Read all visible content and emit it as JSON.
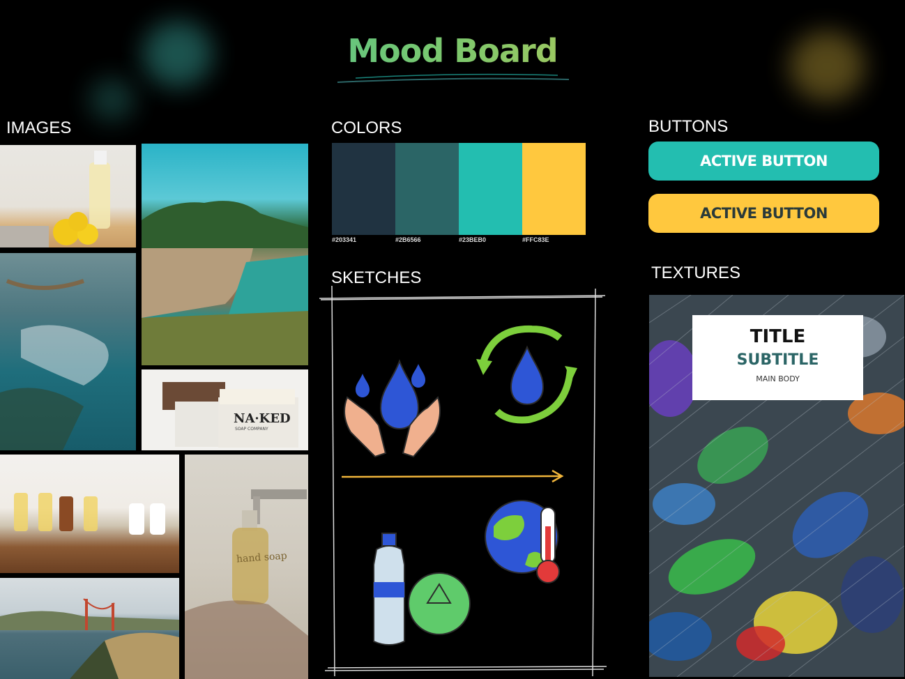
{
  "header": {
    "title": "Mood Board"
  },
  "sections": {
    "images": "IMAGES",
    "colors": "COLORS",
    "sketches": "SKETCHES",
    "buttons": "BUTTONS",
    "textures": "TEXTURES"
  },
  "palette": [
    {
      "hex": "#203341",
      "label": "#203341"
    },
    {
      "hex": "#2B6566",
      "label": "#2B6566"
    },
    {
      "hex": "#23BEB0",
      "label": "#23BEB0"
    },
    {
      "hex": "#FFC83E",
      "label": "#FFC83E"
    }
  ],
  "buttons": {
    "primary_label": "ACTIVE BUTTON",
    "secondary_label": "ACTIVE BUTTON"
  },
  "texture_card": {
    "title": "TITLE",
    "subtitle": "SUBTITLE",
    "body": "MAIN BODY"
  },
  "soap_label": {
    "brand": "NA·KED",
    "sub": "SOAP COMPANY"
  },
  "bottle_text": "hand soap",
  "icons": [
    "water-hands-icon",
    "water-cycle-icon",
    "arrow-right-icon",
    "recycle-bottle-icon",
    "global-warming-icon"
  ]
}
